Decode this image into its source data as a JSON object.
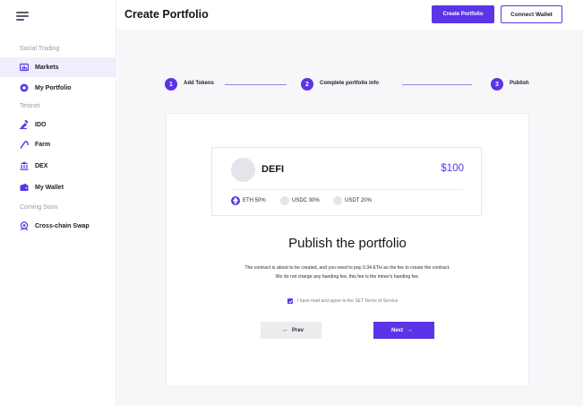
{
  "colors": {
    "accent": "#5a34e6",
    "active_bg": "#eeeefc",
    "main_bg": "#f7f7f9"
  },
  "header": {
    "title": "Create Portfolio",
    "create_button": "Create Portfolio",
    "connect_button": "Connect Wallet"
  },
  "sidebar": {
    "menu_icon": "hamburger-menu-icon",
    "sections": [
      "Social Trading",
      "Testnet",
      "Coming Soon"
    ],
    "items": [
      {
        "label": "Markets",
        "icon": "markets-icon",
        "active": true
      },
      {
        "label": "My Portfolio",
        "icon": "portfolio-icon",
        "active": false
      },
      {
        "label": "IDO",
        "icon": "ido-icon",
        "active": false
      },
      {
        "label": "Farm",
        "icon": "farm-icon",
        "active": false
      },
      {
        "label": "DEX",
        "icon": "bank-icon",
        "active": false
      },
      {
        "label": "My Wallet",
        "icon": "wallet-icon",
        "active": false
      },
      {
        "label": "Cross-chain Swap",
        "icon": "swap-icon",
        "active": false
      }
    ]
  },
  "stepper": {
    "steps": [
      {
        "number": "1",
        "label": "Add Tokens"
      },
      {
        "number": "2",
        "label": "Complete portfolio info"
      },
      {
        "number": "3",
        "label": "Publish"
      }
    ]
  },
  "portfolio": {
    "name": "DEFI",
    "value": "$100",
    "tokens": [
      {
        "label": "ETH 50%",
        "icon": "ethereum-icon"
      },
      {
        "label": "USDC 30%",
        "icon": "usdc-icon"
      },
      {
        "label": "USDT 20%",
        "icon": "usdt-icon"
      }
    ]
  },
  "publish": {
    "title": "Publish the portfolio",
    "line1": "The contract is about to be created, and you need to pay 0.34 ETH as the fee to create the contract.",
    "line2": "We do not charge any handing fee, this fee is the miner's handing fee.",
    "agree_text": "I have read and agree to the SET Terms of Service",
    "prev_label": "Prev",
    "next_label": "Next"
  }
}
